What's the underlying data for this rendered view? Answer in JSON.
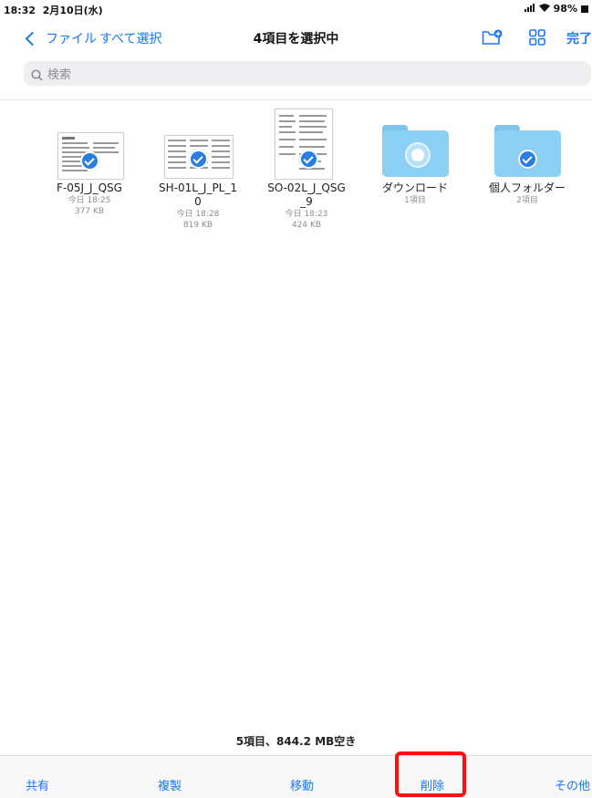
{
  "status": {
    "time": "18:32",
    "date": "2月10日(水)",
    "battery": "98%"
  },
  "nav": {
    "back_label": "ファイル",
    "select_all": "すべて選択",
    "title": "4項目を選択中",
    "done": "完了"
  },
  "search": {
    "placeholder": "検索"
  },
  "items": [
    {
      "name": "F-05J_J_QSG",
      "date": "今日 18:25",
      "size": "377 KB",
      "selected": true,
      "kind": "document"
    },
    {
      "name": "SH-01L_J_PL_1",
      "name2": "0",
      "date": "今日 18:28",
      "size": "819 KB",
      "selected": true,
      "kind": "document"
    },
    {
      "name": "SO-02L_J_QSG",
      "name2": "_9",
      "date": "今日 18:23",
      "size": "424 KB",
      "selected": true,
      "kind": "document"
    },
    {
      "name": "ダウンロード",
      "count": "1項目",
      "selected": false,
      "kind": "folder"
    },
    {
      "name": "個人フォルダー",
      "count": "2項目",
      "selected": true,
      "kind": "folder"
    }
  ],
  "footer": {
    "info": "5項目、844.2 MB空き"
  },
  "toolbar": {
    "share": "共有",
    "duplicate": "複製",
    "move": "移動",
    "delete": "削除",
    "more": "その他"
  },
  "colors": {
    "accent": "#1877f2",
    "selected_check": "#2a7de1",
    "highlight": "#ff1010",
    "folder": "#8dd0f5"
  }
}
